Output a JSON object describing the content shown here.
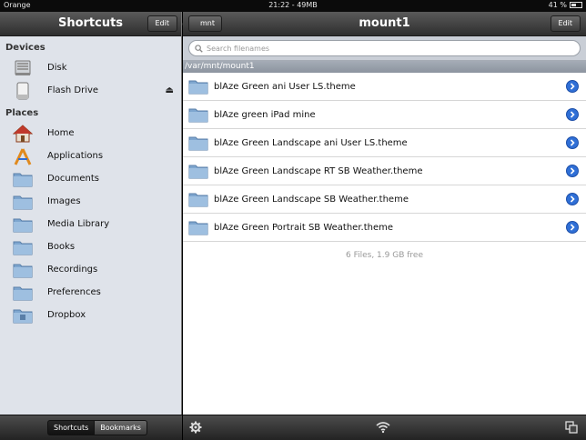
{
  "status_bar": {
    "carrier": "Orange",
    "time": "21:22 - 49MB",
    "battery": "41 %"
  },
  "sidebar": {
    "title": "Shortcuts",
    "edit_label": "Edit",
    "devices_heading": "Devices",
    "devices": [
      {
        "label": "Disk",
        "icon": "disk-icon"
      },
      {
        "label": "Flash Drive",
        "icon": "flash-drive-icon"
      }
    ],
    "places_heading": "Places",
    "places": [
      {
        "label": "Home",
        "icon": "home-icon"
      },
      {
        "label": "Applications",
        "icon": "applications-icon"
      },
      {
        "label": "Documents",
        "icon": "folder-icon"
      },
      {
        "label": "Images",
        "icon": "folder-icon"
      },
      {
        "label": "Media Library",
        "icon": "folder-icon"
      },
      {
        "label": "Books",
        "icon": "folder-icon"
      },
      {
        "label": "Recordings",
        "icon": "folder-icon"
      },
      {
        "label": "Preferences",
        "icon": "folder-icon"
      },
      {
        "label": "Dropbox",
        "icon": "folder-icon"
      }
    ],
    "footer_tabs": [
      "Shortcuts",
      "Bookmarks"
    ]
  },
  "main": {
    "back_label": "mnt",
    "title": "mount1",
    "edit_label": "Edit",
    "search_placeholder": "Search filenames",
    "path": "/var/mnt/mount1",
    "files": [
      "blAze Green ani User LS.theme",
      "blAze green iPad mine",
      "blAze Green Landscape ani User LS.theme",
      "blAze Green Landscape RT SB Weather.theme",
      "blAze Green Landscape SB Weather.theme",
      "blAze Green Portrait SB Weather.theme"
    ],
    "summary": "6 Files, 1.9 GB free"
  },
  "colors": {
    "accent_blue": "#2f6fd6",
    "folder_blue": "#7ea6cf",
    "toolbar_dark": "#2e2e2e"
  }
}
